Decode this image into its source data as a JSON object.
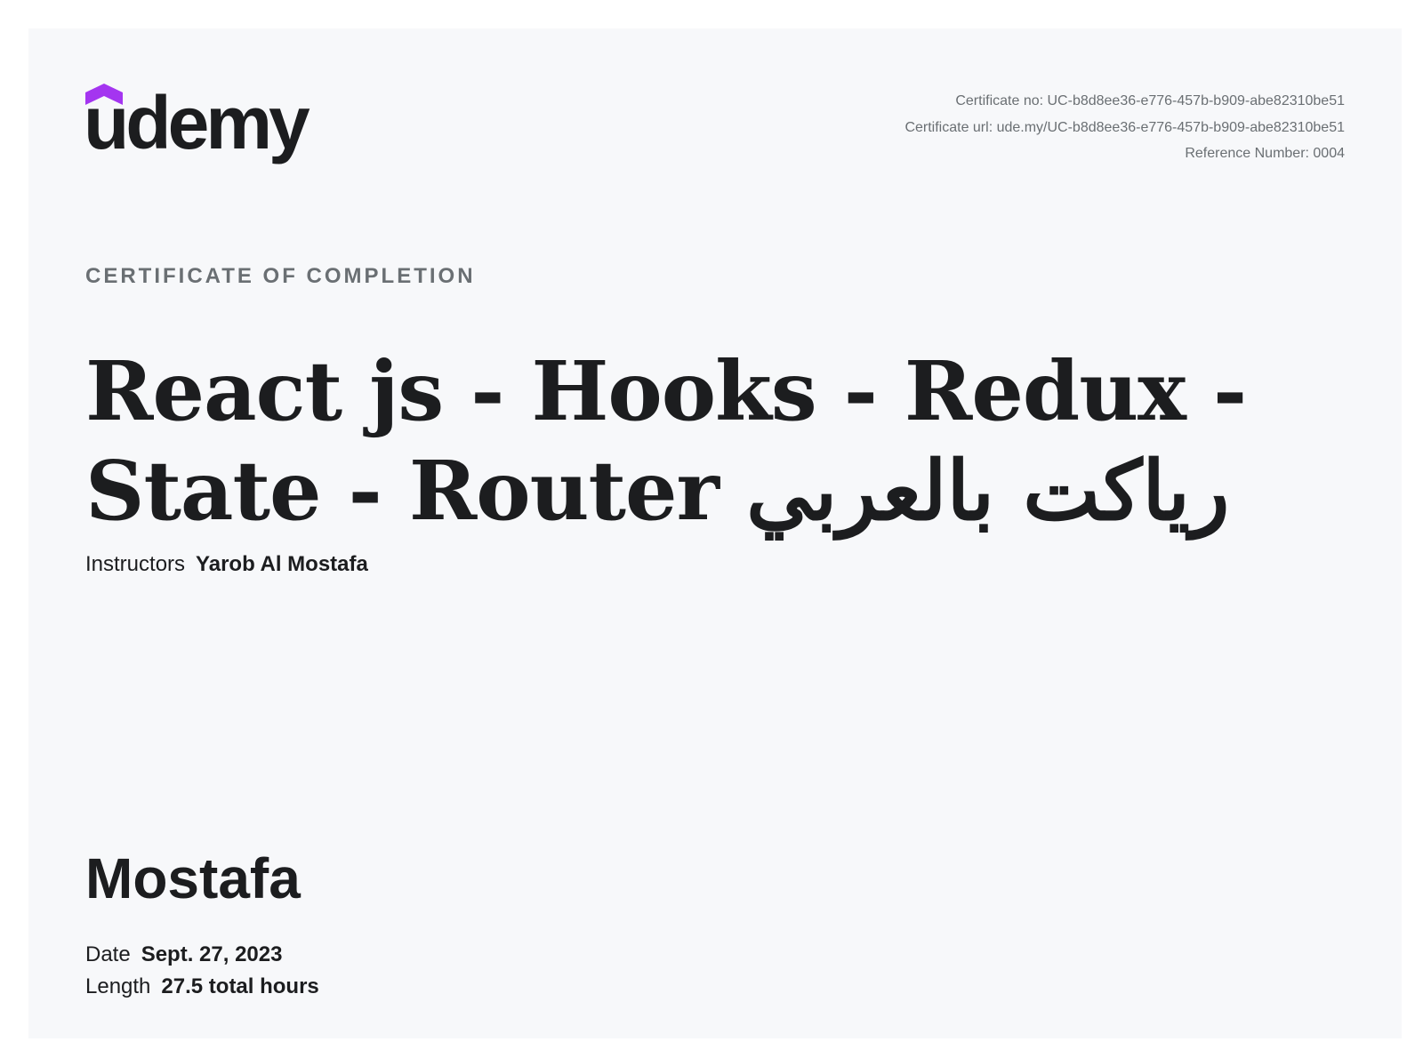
{
  "brand": {
    "name": "udemy",
    "accent_color": "#a435f0",
    "text_color": "#1c1d1f"
  },
  "certificate": {
    "number_line": "Certificate no: UC-b8d8ee36-e776-457b-b909-abe82310be51",
    "url_line": "Certificate url: ude.my/UC-b8d8ee36-e776-457b-b909-abe82310be51",
    "reference_line": "Reference Number: 0004",
    "eyebrow": "CERTIFICATE OF COMPLETION"
  },
  "course": {
    "title": "React js - Hooks - Redux - State - Router رياكت بالعربي",
    "instructors_label": "Instructors",
    "instructors": "Yarob Al Mostafa"
  },
  "recipient": {
    "name": "Mostafa"
  },
  "details": {
    "date_label": "Date",
    "date": "Sept. 27, 2023",
    "length_label": "Length",
    "length": "27.5 total hours"
  }
}
